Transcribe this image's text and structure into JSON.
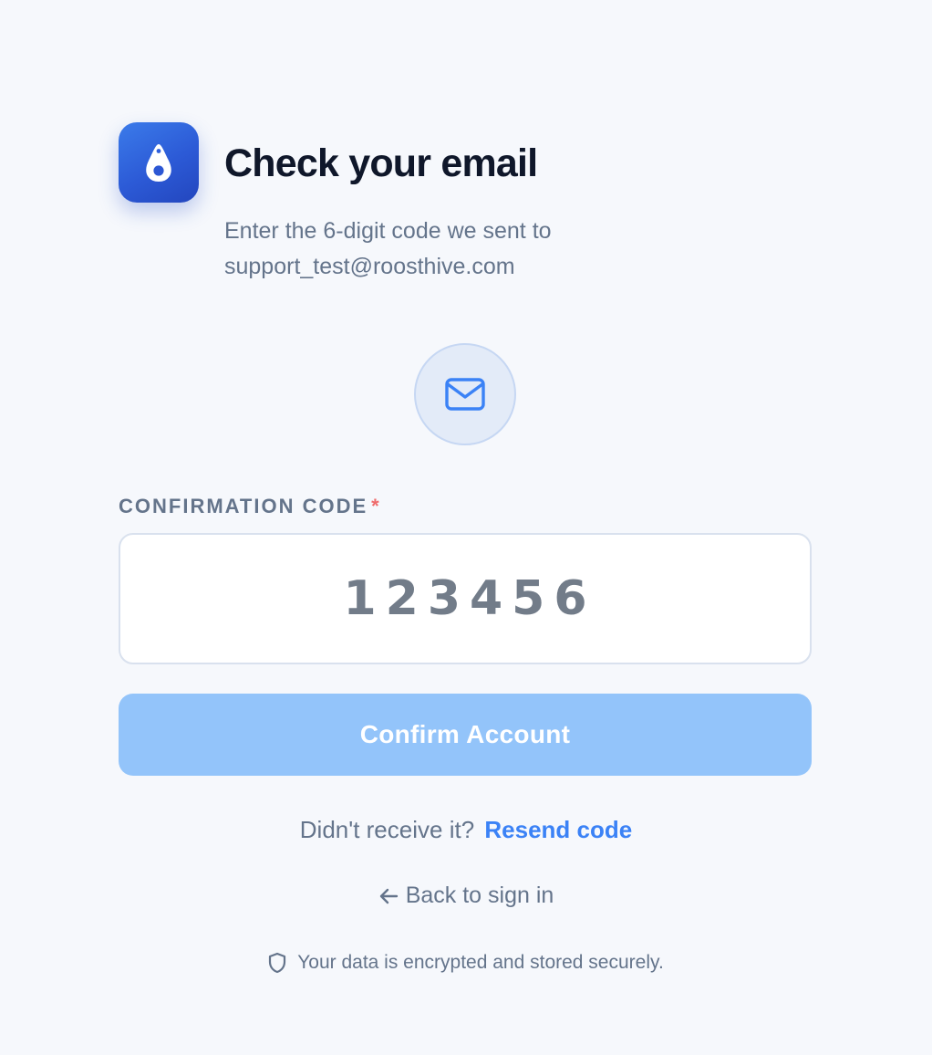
{
  "brand": {
    "logo_icon": "droplet-logo-icon",
    "accent_color": "#2c5ad6"
  },
  "header": {
    "title": "Check your email",
    "subtitle_line1": "Enter the 6-digit code we sent to",
    "email": "support_test@roosthive.com"
  },
  "mail_badge": {
    "icon": "mail-icon"
  },
  "form": {
    "label": "CONFIRMATION CODE",
    "required_marker": "*",
    "code_value": "123456",
    "confirm_label": "Confirm Account",
    "confirm_color": "#93c4fa"
  },
  "resend": {
    "prompt": "Didn't receive it?",
    "link_label": "Resend code",
    "link_color": "#3b82f6"
  },
  "back": {
    "icon": "arrow-left-icon",
    "label": "Back to sign in"
  },
  "security": {
    "icon": "shield-icon",
    "text": "Your data is encrypted and stored securely."
  }
}
